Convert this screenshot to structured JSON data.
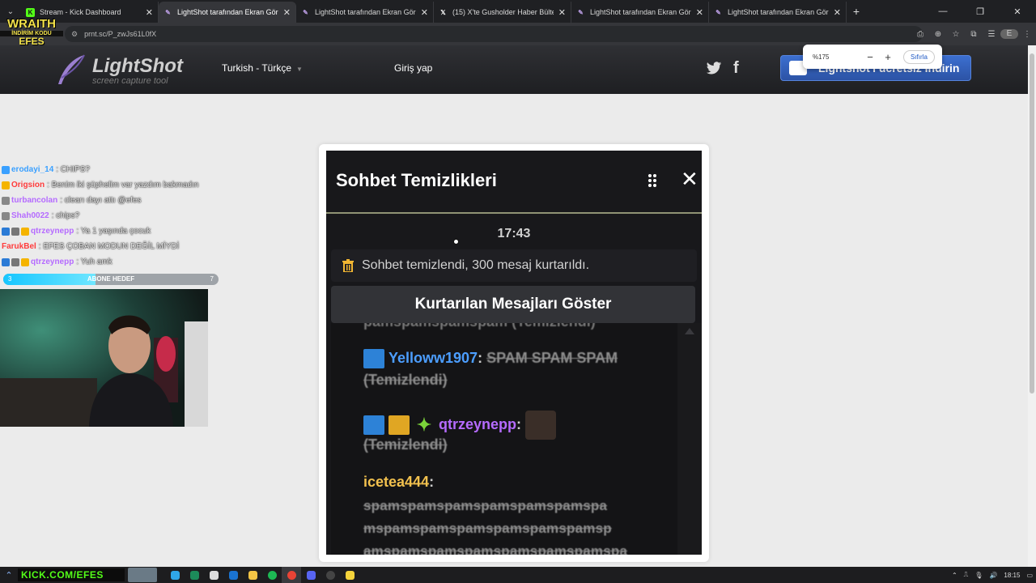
{
  "browser": {
    "tabs": [
      {
        "title": "Stream - Kick Dashboard",
        "favicon": "kick-icon",
        "active": false
      },
      {
        "title": "LightShot tarafından Ekran Görü",
        "favicon": "lightshot-feather-icon",
        "active": true
      },
      {
        "title": "LightShot tarafından Ekran Görü",
        "favicon": "lightshot-feather-icon",
        "active": false
      },
      {
        "title": "(15) X'te Gusholder Haber Bülte",
        "favicon": "x-icon",
        "active": false
      },
      {
        "title": "LightShot tarafından Ekran Görü",
        "favicon": "lightshot-feather-icon",
        "active": false
      },
      {
        "title": "LightShot tarafından Ekran Görü",
        "favicon": "lightshot-feather-icon",
        "active": false
      }
    ],
    "new_tab": "+",
    "url": "prnt.sc/P_zwJs61L0fX",
    "zoom": {
      "value": "%175",
      "minus": "−",
      "plus": "+",
      "reset": "Sıfırla"
    }
  },
  "overlay_brand": {
    "line1": "WRAITH",
    "line2": "İNDİRİM KODU",
    "line3": "EFES"
  },
  "lightshot": {
    "logo": "LightShot",
    "logo_sub": "screen capture tool",
    "language": "Turkish - Türkçe",
    "login": "Giriş yap",
    "download": "Lightshot'ı ücretsiz indirin"
  },
  "stream_chat": [
    {
      "user": "erodayi_14",
      "user_color": "#3aa0ff",
      "message": ": CHIPS?",
      "badge_color": "#3aa0ff"
    },
    {
      "user": "Origsion",
      "user_color": "#ff3b3b",
      "message": ": Benim iki şüphelim var yazdım bakmadın",
      "badge_color": "#f5b400"
    },
    {
      "user": "turbancolan",
      "user_color": "#b56bff",
      "message": ": clearı dayı attı @efes",
      "badge_color": "#888"
    },
    {
      "user": "Shah0022",
      "user_color": "#b56bff",
      "message": ": chips?",
      "badge_color": "#888"
    },
    {
      "user": "qtrzeynepp",
      "user_color": "#b56bff",
      "message": ": Ya 1 yaşında çocuk",
      "badge_color": "#2b7bd6"
    },
    {
      "user": "FarukBel",
      "user_color": "#ff3b3b",
      "message": ": EFES ÇOBAN MODUN DEĞİL MİYDİ",
      "badge_color": ""
    },
    {
      "user": "qtrzeynepp",
      "user_color": "#b56bff",
      "message": ": Yuh amk",
      "badge_color": "#2b7bd6"
    }
  ],
  "sub_goal": {
    "label": "ABONE HEDEF",
    "start": "3",
    "end": "7",
    "progress": 0.43
  },
  "screenshot": {
    "title": "Sohbet Temizlikleri",
    "time": "17:43",
    "info": "Sohbet temizlendi, 300 mesaj kurtarıldı.",
    "show_button": "Kurtarılan Mesajları Göster",
    "partial_line": "pamspamspamspam (Temizlendi)",
    "messages": [
      {
        "user": "Yelloww1907",
        "user_color": "#4c9eff",
        "text": "SPAM SPAM SPAM",
        "cleared": "(Temizlendi)"
      },
      {
        "user": "qtrzeynepp",
        "user_color": "#b56bff",
        "text": "",
        "cleared": "(Temizlendi)"
      },
      {
        "user": "icetea444",
        "user_color": "#f2c14e",
        "lines": [
          "spamspamspamspamspamspamspa",
          "mspamspamspamspamspamspamsp",
          "amspamspamspamspamspamspamspa"
        ]
      }
    ]
  },
  "taskbar": {
    "url_text": "KICK.COM/EFES",
    "apps": [
      "chrome",
      "discord",
      "spotify",
      "explorer",
      "obs"
    ],
    "time": "18:15"
  },
  "colors": {
    "accent": "#3c6fd0",
    "kick_green": "#53fc18"
  }
}
